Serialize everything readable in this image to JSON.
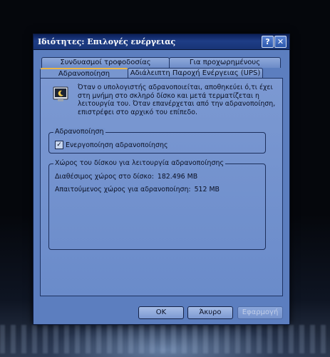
{
  "window": {
    "title": "Ιδιότητες: Επιλογές ενέργειας",
    "help_label": "?",
    "close_label": "✕"
  },
  "tabs": [
    {
      "label": "Συνδυασμοί τροφοδοσίας"
    },
    {
      "label": "Για προχωρημένους"
    },
    {
      "label": "Αδρανοποίηση",
      "selected": true
    },
    {
      "label": "Αδιάλειπτη Παροχή Ενέργειας (UPS)"
    }
  ],
  "description": "Όταν ο υπολογιστής αδρανοποιείται, αποθηκεύει ό,τι έχει στη μνήμη στο σκληρό δίσκο και μετά τερματίζεται η λειτουργία του. Όταν επανέρχεται από την αδρανοποίηση, επιστρέφει στο αρχικό του επίπεδο.",
  "hibernate_group": {
    "title": "Αδρανοποίηση",
    "checkbox_label": "Ενεργοποίηση αδρανοποίησης",
    "checked": true
  },
  "disk_group": {
    "title": "Χώρος του δίσκου για λειτουργία αδρανοποίησης",
    "free_label": "Διαθέσιμος χώρος στο δίσκο:",
    "free_value": "182.496 MB",
    "required_label": "Απαιτούμενος χώρος για αδρανοποίηση:",
    "required_value": "512 MB"
  },
  "buttons": {
    "ok": "OK",
    "cancel": "Άκυρο",
    "apply": "Εφαρμογή"
  },
  "colors": {
    "title_bar": "#1e3d86",
    "window_bg": "#5c7ebf",
    "panel_bg": "#7594cf",
    "active_tab_accent": "#e8b64a"
  }
}
